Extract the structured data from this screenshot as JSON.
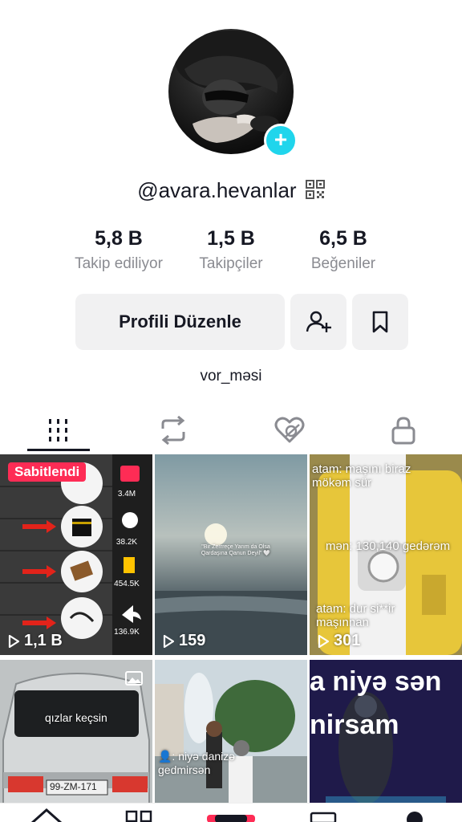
{
  "profile": {
    "username": "@avara.hevanlar",
    "bio": "vor_məsi"
  },
  "stats": [
    {
      "value": "5,8 B",
      "label": "Takip ediliyor"
    },
    {
      "value": "1,5 B",
      "label": "Takipçiler"
    },
    {
      "value": "6,5 B",
      "label": "Beğeniler"
    }
  ],
  "actions": {
    "edit_profile": "Profili Düzenle"
  },
  "tabs": [
    {
      "name": "videos",
      "icon": "grid-icon",
      "active": true
    },
    {
      "name": "reposts",
      "icon": "repost-icon",
      "active": false
    },
    {
      "name": "liked",
      "icon": "liked-hidden-icon",
      "active": false
    },
    {
      "name": "private",
      "icon": "lock-icon",
      "active": false
    }
  ],
  "videos": [
    {
      "views": "1,1 B",
      "pinned_label": "Sabitlendi",
      "side_counts": [
        "3.4M",
        "38.2K",
        "454.5K",
        "136.9K"
      ]
    },
    {
      "views": "159",
      "caption": "\"Bir Zerrreçe Yarım da Olsa Qardaşına Qanun Deyil\" 🤍"
    },
    {
      "views": "301",
      "lines": [
        "atam: maşını biraz mökəm sür",
        "mən: 130,140 gedərəm",
        "atam: dur si**ir maşınnan"
      ]
    },
    {
      "caption": "qızlar keçsin",
      "plate": "99-ZM-171"
    },
    {
      "caption": "👤: niyə danizə gedmirsən"
    },
    {
      "lines": [
        "a niyə sən",
        "nirsam"
      ]
    }
  ],
  "colors": {
    "accent": "#20d5ec",
    "pinned": "#fe2c55",
    "muted_text": "#8a8b91"
  }
}
